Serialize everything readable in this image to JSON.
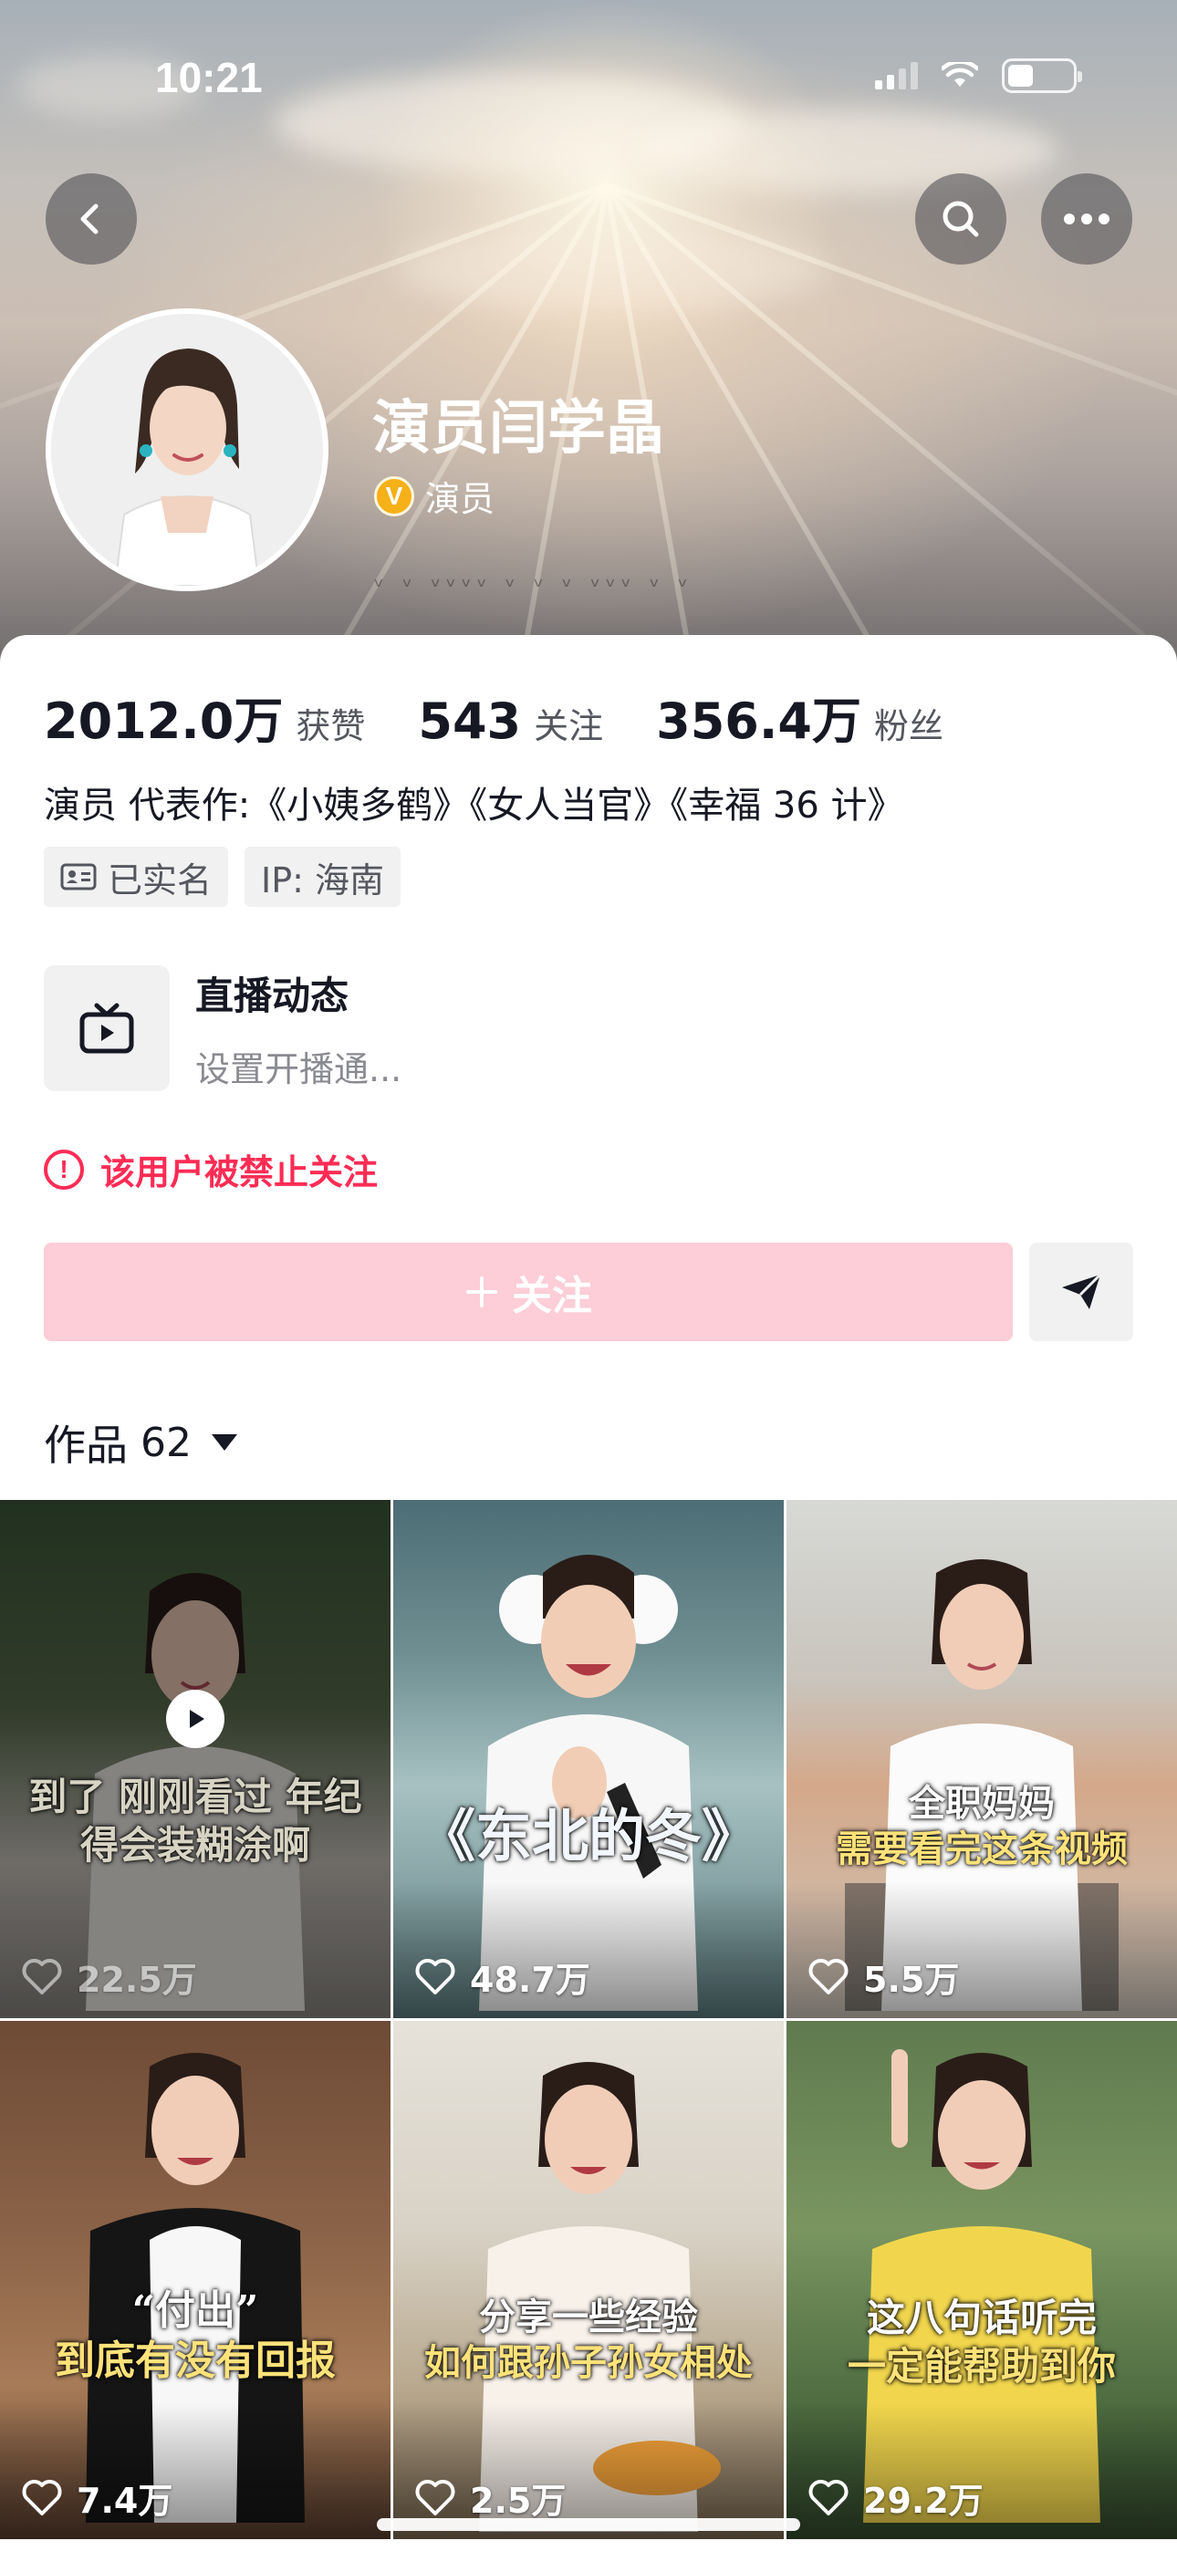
{
  "status_bar": {
    "time": "10:21"
  },
  "header": {
    "name": "演员闫学晶",
    "verified_label": "演员",
    "buttons": [
      "back-icon",
      "search-icon",
      "more-icon"
    ]
  },
  "stats": [
    {
      "value": "2012.0万",
      "label": "获赞"
    },
    {
      "value": "543",
      "label": "关注"
    },
    {
      "value": "356.4万",
      "label": "粉丝"
    }
  ],
  "bio": "演员 代表作:《小姨多鹤》《女人当官》《幸福 36 计》",
  "tags": [
    {
      "icon": "id-card-icon",
      "text": "已实名"
    },
    {
      "icon": "",
      "text": "IP: 海南"
    }
  ],
  "live": {
    "title": "直播动态",
    "subtitle": "设置开播通..."
  },
  "banned_notice": "该用户被禁止关注",
  "follow_button": {
    "label": "关注"
  },
  "works_tab": {
    "label": "作品",
    "count": "62"
  },
  "videos": [
    {
      "caption_lines": [
        "到了 刚刚看过 年纪",
        "得会装糊涂啊"
      ],
      "likes": "22.5万",
      "watched": true
    },
    {
      "caption_lines": [
        "《东北的冬》"
      ],
      "likes": "48.7万",
      "watched": false
    },
    {
      "caption_lines": [
        "全职妈妈",
        "需要看完这条视频"
      ],
      "likes": "5.5万",
      "watched": false
    },
    {
      "caption_lines": [
        "“付出”",
        "到底有没有回报"
      ],
      "likes": "7.4万",
      "watched": false
    },
    {
      "caption_lines": [
        "分享一些经验",
        "如何跟孙子孙女相处"
      ],
      "likes": "2.5万",
      "watched": false
    },
    {
      "caption_lines": [
        "这八句话听完",
        "一定能帮助到你"
      ],
      "likes": "29.2万",
      "watched": false
    }
  ],
  "colors": {
    "accent": "#fe2c55",
    "follow_disabled": "#fdcdd8",
    "verified": "#f6b018"
  }
}
